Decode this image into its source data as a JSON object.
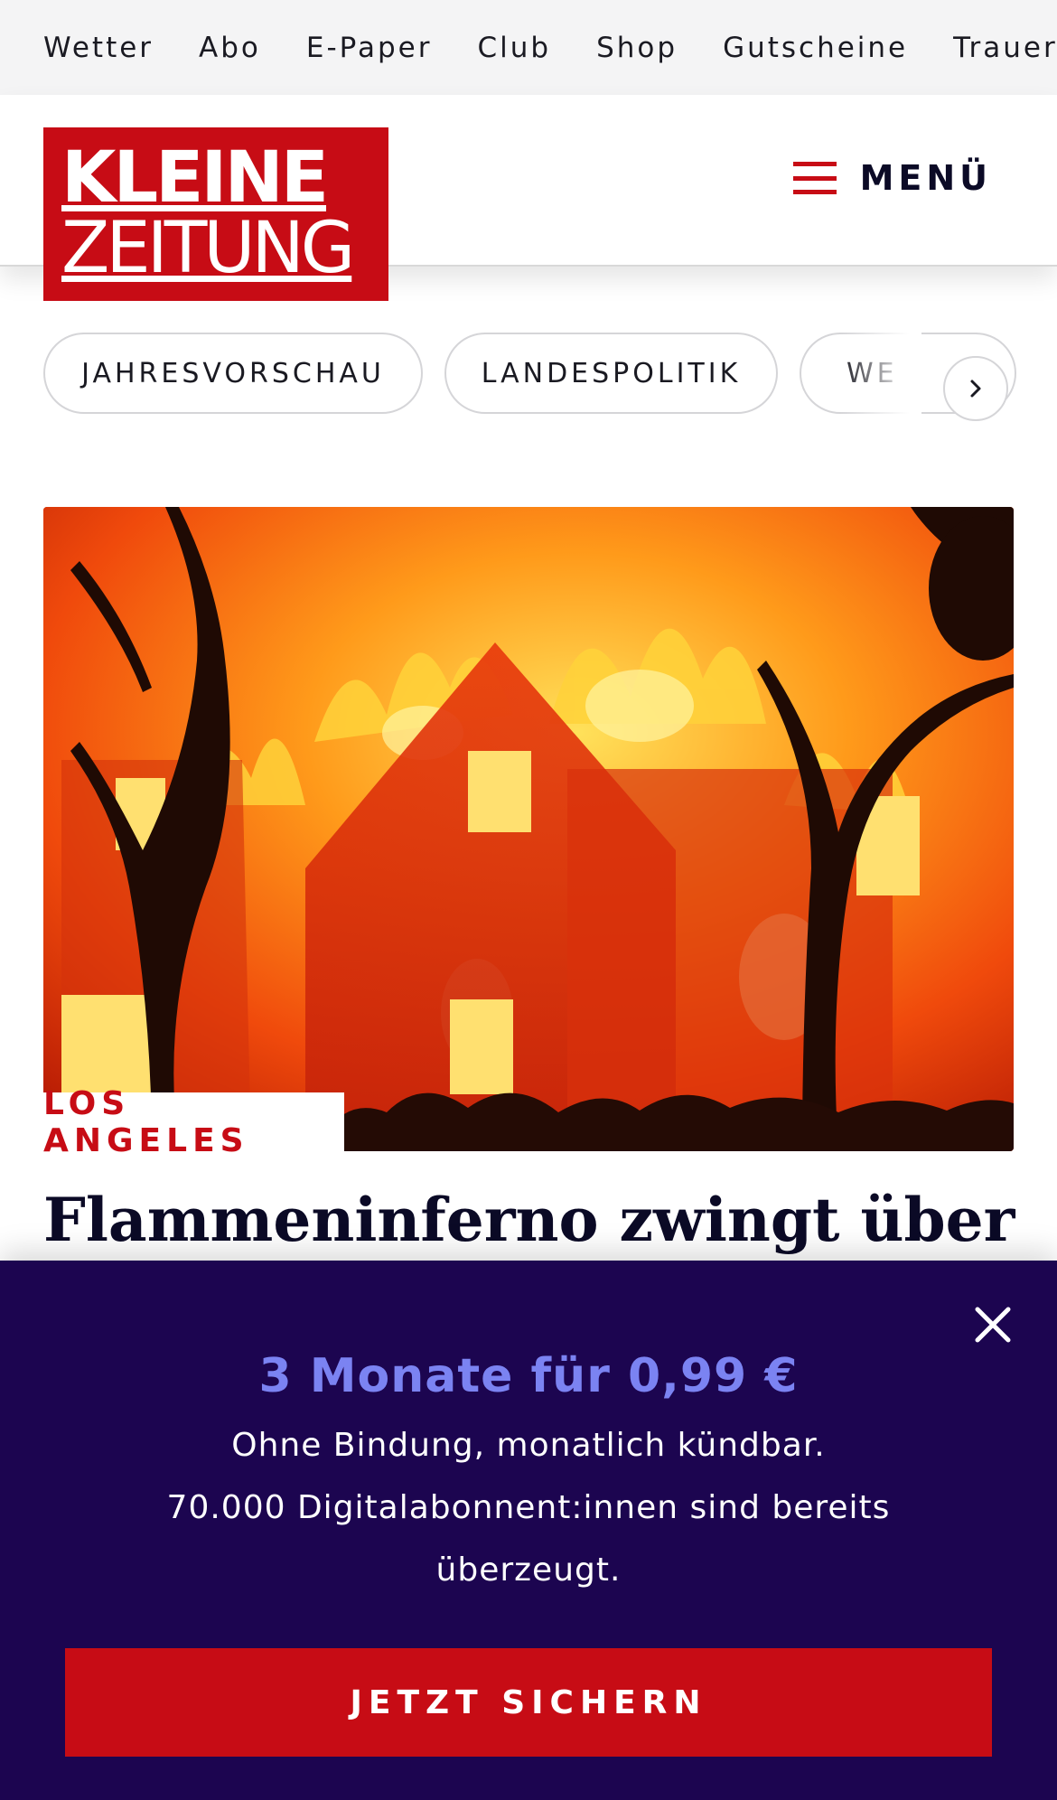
{
  "topnav": {
    "items": [
      "Wetter",
      "Abo",
      "E-Paper",
      "Club",
      "Shop",
      "Gutscheine",
      "Trauerpo"
    ]
  },
  "header": {
    "logo_line1": "KLEINE",
    "logo_line2": "ZEITUNG",
    "menu_label": "MENÜ",
    "brand_color": "#c70c15"
  },
  "topics": {
    "items": [
      "JAHRESVORSCHAU",
      "LANDESPOLITIK",
      "WE"
    ],
    "next_icon": "chevron-right-icon"
  },
  "article": {
    "kicker": "LOS ANGELES",
    "headline": "Flammeninferno zwingt über",
    "image_icon": "burning-house-photo"
  },
  "promo": {
    "title": "3 Monate für 0,99 €",
    "line1": "Ohne Bindung, monatlich kündbar.",
    "line2": "70.000 Digitalabonnent:innen sind bereits überzeugt.",
    "cta_label": "JETZT SICHERN",
    "close_icon": "close-icon",
    "background_color": "#1c0550",
    "title_color": "#7b83f2"
  }
}
